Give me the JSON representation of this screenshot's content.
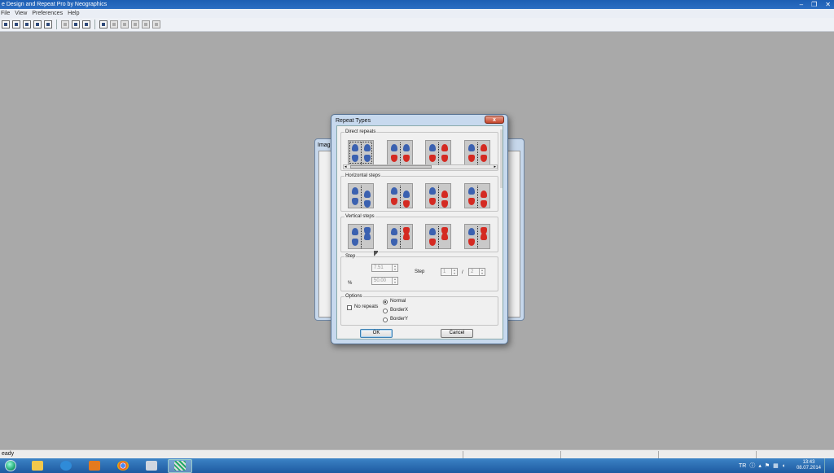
{
  "app": {
    "title": "e Design and Repeat Pro by Neographics",
    "controls": [
      "–",
      "❐",
      "✕"
    ],
    "menu": [
      "File",
      "View",
      "Preferences",
      "Help"
    ],
    "status": "eady"
  },
  "back_dialog": {
    "title": "Imag"
  },
  "dialog": {
    "title": "Repeat Types",
    "close": "x",
    "groups": {
      "direct": "Direct repeats",
      "horizontal": "Horizontal steps",
      "vertical": "Vertical steps",
      "step": "Step",
      "options": "Options"
    },
    "step": {
      "field1": "7.51",
      "field2": "50.00",
      "percent_label": "%",
      "step_label": "Step",
      "step_a": "1",
      "step_sep": "/",
      "step_b": "2"
    },
    "options": {
      "no_repeats": "No repeats",
      "radios": [
        "Normal",
        "BorderX",
        "BorderY"
      ],
      "selected": 0
    },
    "ok": "OK",
    "cancel": "Cancel"
  },
  "tray": {
    "lang": "TR",
    "time": "13:43",
    "date": "08.07.2014"
  },
  "colors": {
    "blue_mark": "#3b61b0",
    "red_mark": "#d42a22",
    "desktop": "#a9a9a9"
  }
}
